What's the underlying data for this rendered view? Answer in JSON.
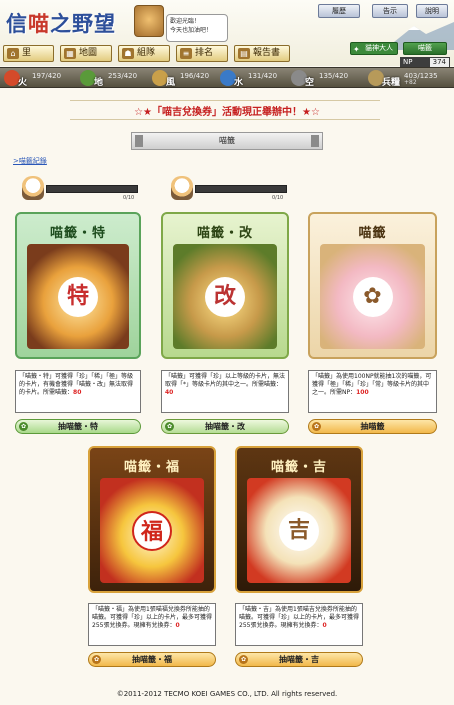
{
  "header": {
    "logo_part1": "信",
    "logo_red": "喵",
    "logo_part2": "之野望",
    "speech": [
      "歡迎光臨！",
      "今天也加油吧！"
    ],
    "top_buttons": [
      "履歷",
      "告示",
      "說明"
    ],
    "nav": [
      {
        "label": "里",
        "icon": "village-icon"
      },
      {
        "label": "地圖",
        "icon": "map-icon"
      },
      {
        "label": "組隊",
        "icon": "team-icon"
      },
      {
        "label": "排名",
        "icon": "ranking-icon"
      },
      {
        "label": "報告書",
        "icon": "report-icon"
      }
    ],
    "god_label": "貓神大人",
    "lottery_label": "喵籤",
    "np_label": "NP",
    "np_value": "374"
  },
  "resources": [
    {
      "label": "火",
      "value": "197/420",
      "color": "#d44a2a"
    },
    {
      "label": "地",
      "value": "253/420",
      "color": "#5a9a3a"
    },
    {
      "label": "風",
      "value": "196/420",
      "color": "#c9a04a"
    },
    {
      "label": "水",
      "value": "131/420",
      "color": "#3a7ac8"
    },
    {
      "label": "空",
      "value": "135/420",
      "color": "#8a8a8a"
    },
    {
      "label": "兵糧",
      "value": "403/1235",
      "extra": "+82",
      "color": "#b79a5a"
    }
  ],
  "banner": "☆★「喵吉兌換券」活動現正舉辦中！★☆",
  "section_title": "喵籤",
  "history_link": ">喵籤紀錄",
  "progress": [
    {
      "count": "0/10",
      "fraction": 0
    },
    {
      "count": "0/10",
      "fraction": 0
    }
  ],
  "cards": [
    {
      "title": "喵籤・特",
      "desc": "「喵籤・特」可獲得「珍」「稀」「極」等級的卡片，有機會獲得「喵籤・改」無法取得的卡片。所需喵籤：",
      "cost": "80",
      "button": "抽喵籤・特"
    },
    {
      "title": "喵籤・改",
      "desc": "「喵籤」可獲得「珍」以上等級的卡片，無法取得「*」等級卡片的其中之一。所需喵籤：",
      "cost": "40",
      "button": "抽喵籤・改"
    },
    {
      "title": "喵籤",
      "desc": "「喵籤」為使用100NP就能抽1次的喵籤，可獲得「極」「稀」「珍」「常」等級卡片的其中之一。所需NP：",
      "cost": "100",
      "button": "抽喵籤"
    },
    {
      "title": "喵籤・福",
      "desc": "「喵籤・福」為使用1張喵福兌換券所能抽的喵籤。可獲得「珍」以上的卡片，最多可獲得255張兌換券。現擁有兌換券：",
      "cost": "0",
      "button": "抽喵籤・福"
    },
    {
      "title": "喵籤・吉",
      "desc": "「喵籤・吉」為使用1張喵吉兌換券所能抽的喵籤。可獲得「珍」以上的卡片，最多可獲得255張兌換券。現擁有兌換券：",
      "cost": "0",
      "button": "抽喵籤・吉"
    }
  ],
  "footer": "©2011-2012 TECMO KOEI GAMES CO., LTD. All rights reserved."
}
